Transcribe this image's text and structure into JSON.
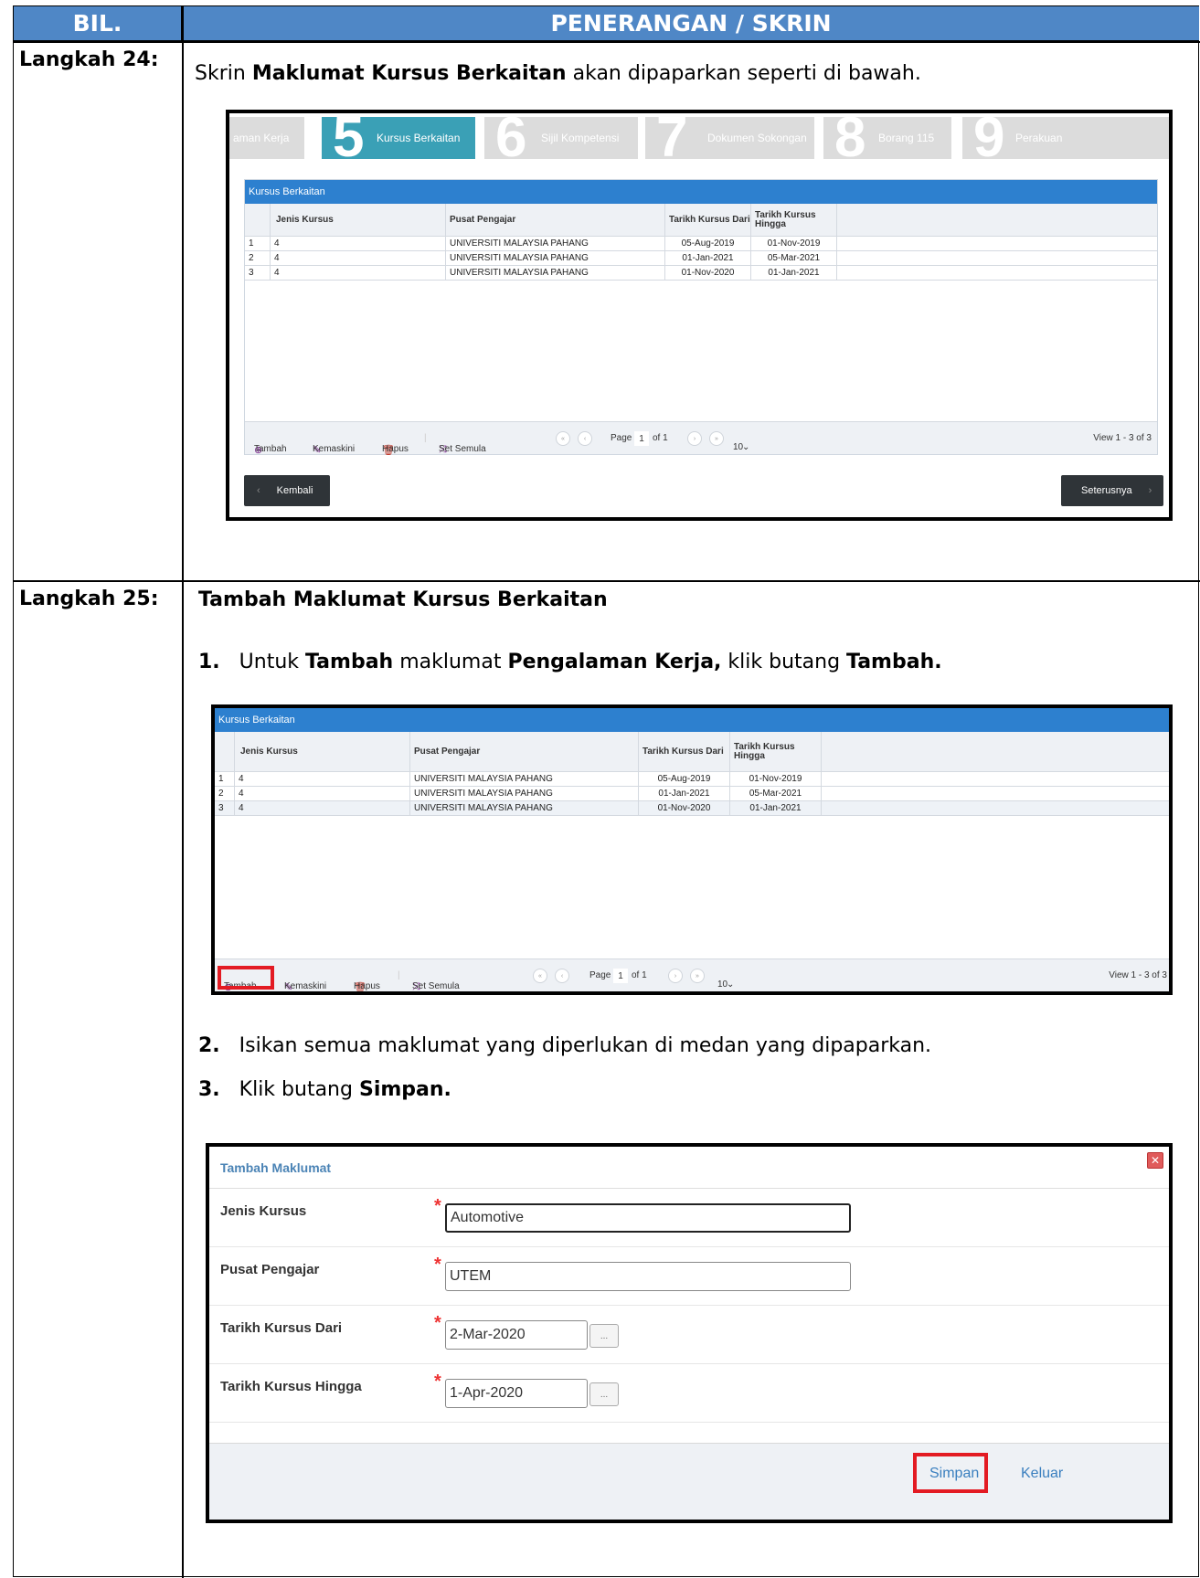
{
  "header": {
    "col1": "BIL.",
    "col2": "PENERANGAN / SKRIN"
  },
  "step24": {
    "label": "Langkah 24:",
    "text_pre": "Skrin ",
    "text_bold": "Maklumat Kursus Berkaitan",
    "text_post": " akan dipaparkan seperti di bawah."
  },
  "step25": {
    "label": "Langkah 25:",
    "heading": "Tambah Maklumat Kursus Berkaitan",
    "item1": {
      "num": "1.",
      "pre": "Untuk ",
      "b1": "Tambah",
      "mid": " maklumat ",
      "b2": "Pengalaman Kerja,",
      "mid2": " klik butang ",
      "b3": "Tambah."
    },
    "item2": {
      "num": "2.",
      "text": "Isikan semua maklumat yang diperlukan di medan yang dipaparkan."
    },
    "item3": {
      "num": "3.",
      "pre": "Klik butang ",
      "b1": "Simpan."
    }
  },
  "wizard": {
    "tabs": [
      {
        "num": "",
        "label": "aman Kerja"
      },
      {
        "num": "5",
        "label": "Kursus Berkaitan"
      },
      {
        "num": "6",
        "label": "Sijil Kompetensi"
      },
      {
        "num": "7",
        "label": "Dokumen Sokongan"
      },
      {
        "num": "8",
        "label": "Borang 115"
      },
      {
        "num": "9",
        "label": "Perakuan"
      }
    ]
  },
  "grid": {
    "title": "Kursus Berkaitan",
    "columns": [
      "Jenis Kursus",
      "Pusat Pengajar",
      "Tarikh Kursus Dari",
      "Tarikh Kursus Hingga"
    ],
    "rows": [
      {
        "no": "1",
        "jenis": "4",
        "pusat": "UNIVERSITI MALAYSIA PAHANG",
        "dari": "05-Aug-2019",
        "hingga": "01-Nov-2019"
      },
      {
        "no": "2",
        "jenis": "4",
        "pusat": "UNIVERSITI MALAYSIA PAHANG",
        "dari": "01-Jan-2021",
        "hingga": "05-Mar-2021"
      },
      {
        "no": "3",
        "jenis": "4",
        "pusat": "UNIVERSITI MALAYSIA PAHANG",
        "dari": "01-Nov-2020",
        "hingga": "01-Jan-2021"
      }
    ],
    "actions": {
      "tambah": "Tambah",
      "kemaskini": "Kemaskini",
      "hapus": "Hapus",
      "set_semula": "Set Semula"
    },
    "pager": {
      "page_label": "Page",
      "page_value": "1",
      "of_label": "of 1",
      "rows_per_page": "10",
      "view_label": "View 1 - 3 of 3"
    }
  },
  "nav_buttons": {
    "back": "Kembali",
    "next": "Seterusnya"
  },
  "dialog": {
    "title": "Tambah Maklumat",
    "close": "✕",
    "fields": [
      {
        "label": "Jenis Kursus",
        "value": "Automotive"
      },
      {
        "label": "Pusat Pengajar",
        "value": "UTEM"
      },
      {
        "label": "Tarikh Kursus Dari",
        "value": "2-Mar-2020"
      },
      {
        "label": "Tarikh Kursus Hingga",
        "value": "1-Apr-2020"
      }
    ],
    "cal_label": "...",
    "save": "Simpan",
    "exit": "Keluar"
  },
  "colors": {
    "header_bg": "#4f87c6",
    "grid_title_bg": "#2d80cf",
    "wizard_active": "#3aa0b6",
    "highlight": "#e31b23"
  }
}
